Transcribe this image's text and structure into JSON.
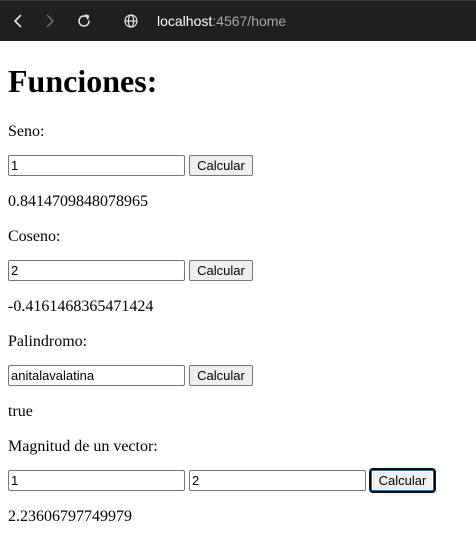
{
  "browser": {
    "url_host": "localhost",
    "url_port_path": ":4567/home"
  },
  "page": {
    "title": "Funciones:",
    "seno": {
      "label": "Seno:",
      "input_value": "1",
      "button_label": "Calcular",
      "result": "0.8414709848078965"
    },
    "coseno": {
      "label": "Coseno:",
      "input_value": "2",
      "button_label": "Calcular",
      "result": "-0.4161468365471424"
    },
    "palindromo": {
      "label": "Palindromo:",
      "input_value": "anitalavalatina",
      "button_label": "Calcular",
      "result": "true"
    },
    "magnitud": {
      "label": "Magnitud de un vector:",
      "input_x_value": "1",
      "input_y_value": "2",
      "button_label": "Calcular",
      "result": "2.23606797749979"
    }
  },
  "colors": {
    "toolbar_bg": "#1f1f1f",
    "button_bg": "#efefef",
    "focus_ring": "#0a6bd6"
  }
}
